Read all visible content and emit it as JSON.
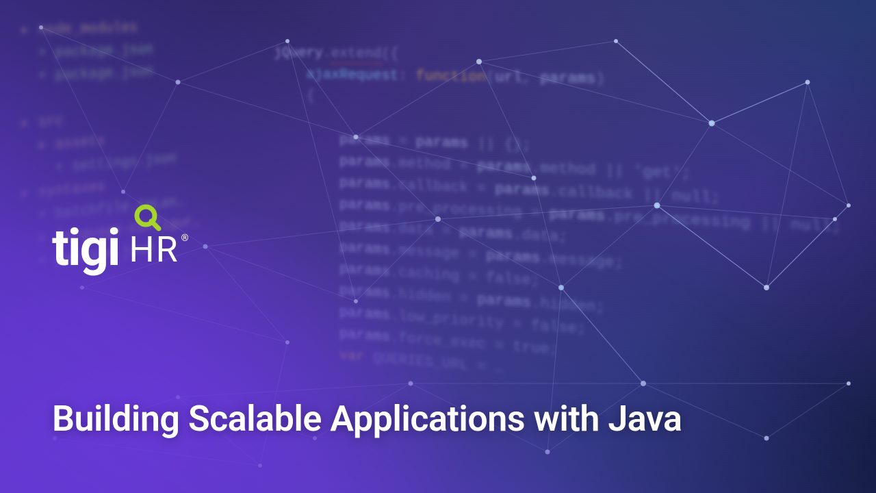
{
  "brand": {
    "name_primary": "tigi",
    "name_secondary": "HR",
    "registered_mark": "®",
    "accent_color": "#a6d62b"
  },
  "headline": "Building Scalable Applications with Java",
  "bg_code": {
    "sidebar_lines": [
      "▸ node_modules",
      "  • package.json",
      "  • package.json",
      "",
      "▸ src",
      "  ▸ assets",
      "    • settings.json",
      "▸ syntaxes",
      "  • batchfile.tmLan…",
      "  ▸ language-configur…",
      "  • package.json"
    ],
    "main_lines": [
      "jQuery.extend({",
      "    ajaxRequest: function(url, params)",
      "    {",
      "",
      "        params = params || {};",
      "        params.method = params.method || 'get';",
      "        params.callback = params.callback || null;",
      "        params.pre_processing = params.pre_processing || null;",
      "        params.data = params.data;",
      "        params.message = params.message;",
      "        params.caching = false;",
      "        params.hidden = params.hidden;",
      "        params.low_priority = false;",
      "        params.force_exec = true;",
      "        var QUERIES_URL = …"
    ]
  }
}
